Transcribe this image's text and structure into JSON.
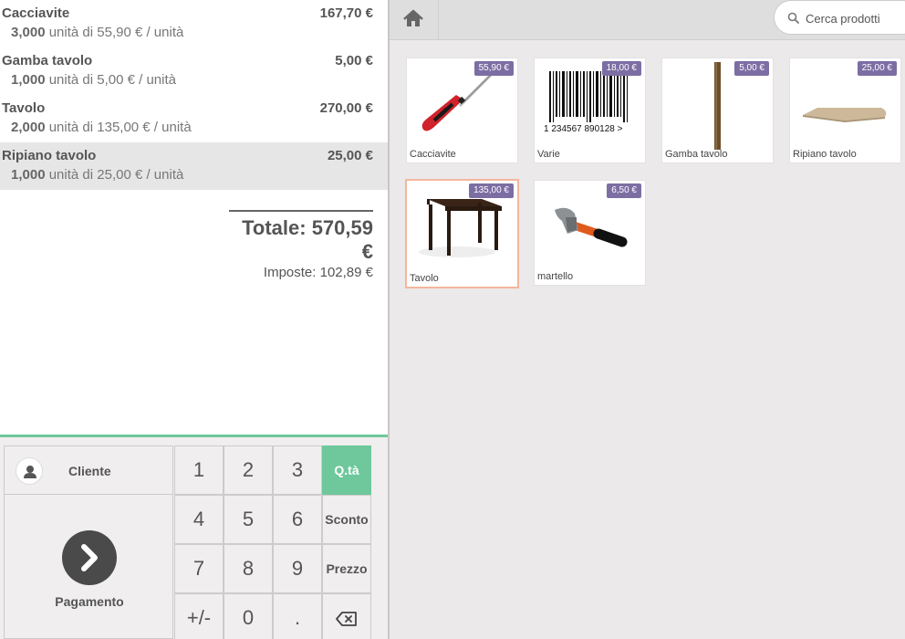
{
  "order": {
    "lines": [
      {
        "name": "Cacciavite",
        "price": "167,70 €",
        "qty": "3,000",
        "unit_info": "unità di 55,90 € / unità"
      },
      {
        "name": "Gamba tavolo",
        "price": "5,00 €",
        "qty": "1,000",
        "unit_info": "unità di 5,00 € / unità"
      },
      {
        "name": "Tavolo",
        "price": "270,00 €",
        "qty": "2,000",
        "unit_info": "unità di 135,00 € / unità"
      },
      {
        "name": "Ripiano tavolo",
        "price": "25,00 €",
        "qty": "1,000",
        "unit_info": "unità di 25,00 € / unità"
      }
    ],
    "total": "Totale: 570,59 €",
    "taxes": "Imposte: 102,89 €"
  },
  "controls": {
    "customer_label": "Cliente",
    "payment_label": "Pagamento",
    "keys": [
      "1",
      "2",
      "3",
      "Q.tà",
      "4",
      "5",
      "6",
      "Sconto",
      "7",
      "8",
      "9",
      "Prezzo",
      "+/-",
      "0",
      "."
    ],
    "active_mode": "Q.tà"
  },
  "search": {
    "placeholder": "Cerca prodotti"
  },
  "products": [
    {
      "name": "Cacciavite",
      "price": "55,90 €",
      "icon": "screwdriver-image"
    },
    {
      "name": "Varie",
      "price": "18,00 €",
      "icon": "barcode-image",
      "barcode_text": "1  234567  890128  >"
    },
    {
      "name": "Gamba tavolo",
      "price": "5,00 €",
      "icon": "table-leg-image"
    },
    {
      "name": "Ripiano tavolo",
      "price": "25,00 €",
      "icon": "table-top-image"
    },
    {
      "name": "Tavolo",
      "price": "135,00 €",
      "icon": "table-image"
    },
    {
      "name": "martello",
      "price": "6,50 €",
      "icon": "hammer-image"
    }
  ],
  "colors": {
    "accent": "#6ec89b",
    "price_tag": "#7c6ea3",
    "selected_border": "#f4b59d"
  }
}
